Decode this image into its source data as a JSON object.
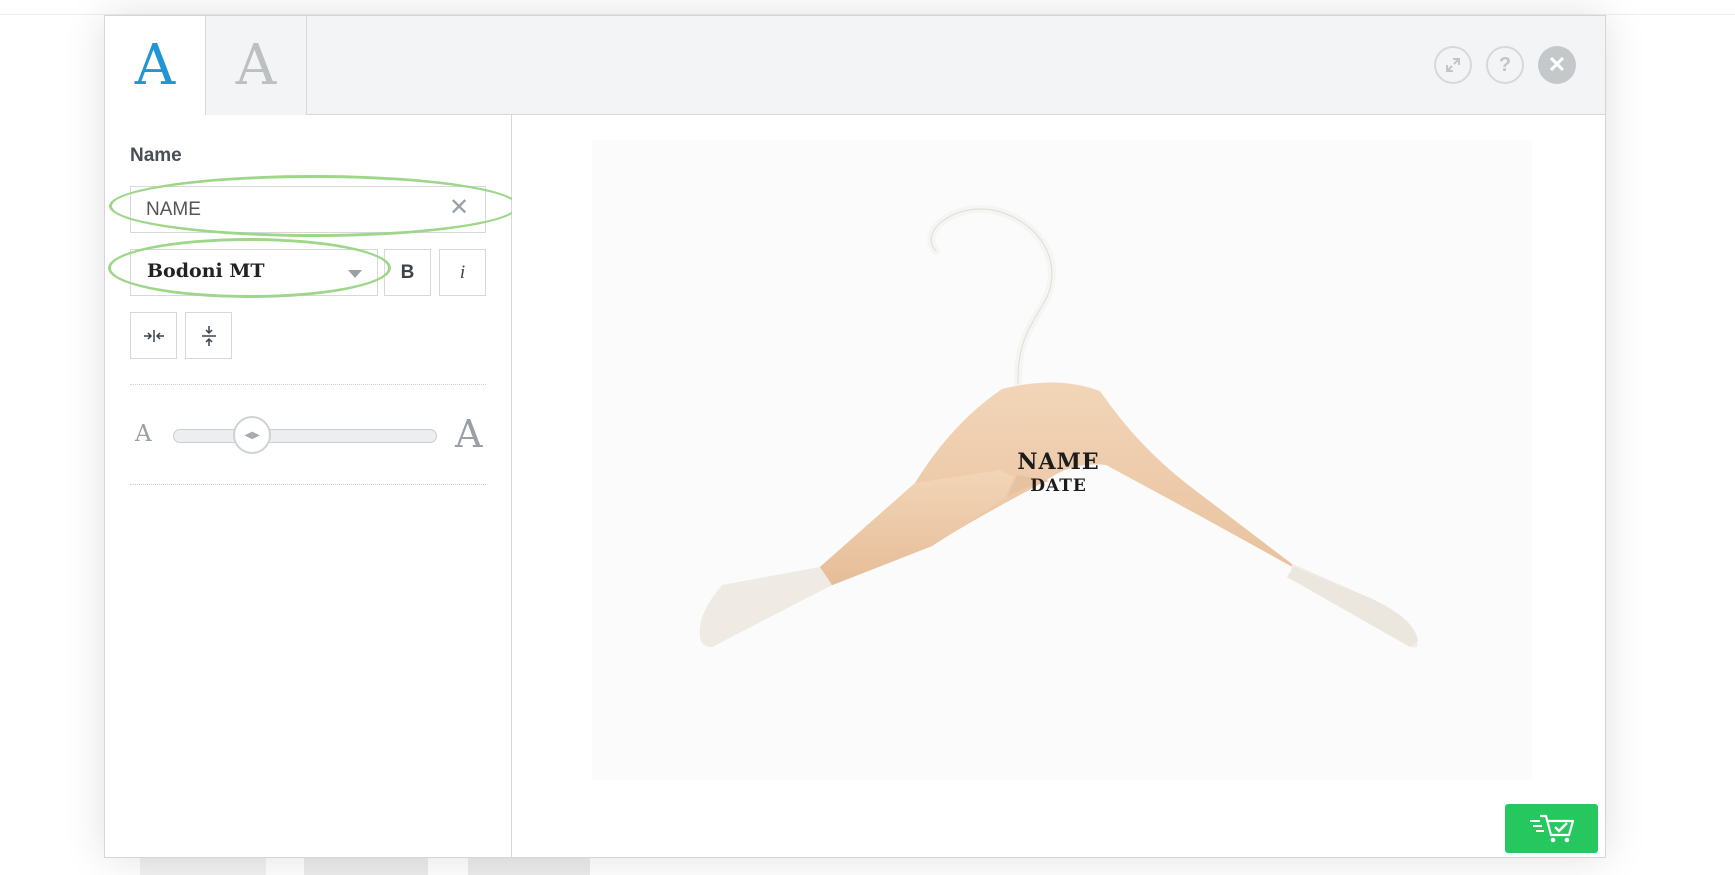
{
  "tabs": [
    {
      "glyph": "A",
      "state": "active"
    },
    {
      "glyph": "A",
      "state": "inactive"
    }
  ],
  "window_controls": {
    "expand_icon": "expand-icon",
    "help_glyph": "?",
    "close_glyph": "✕"
  },
  "editor": {
    "field_label": "Name",
    "text_value": "NAME",
    "clear_glyph": "✕",
    "font_family_value": "Bodoni MT",
    "bold_label": "B",
    "italic_label": "i",
    "size_small_glyph": "A",
    "size_large_glyph": "A",
    "size_slider_value": 0.3
  },
  "preview": {
    "engraving_line1": "NAME",
    "engraving_line2": "DATE"
  },
  "cart": {
    "icon": "cart-check-icon"
  },
  "colors": {
    "accent": "#2196d6",
    "cart_button": "#27c75f",
    "annotation": "#9ed68a"
  }
}
